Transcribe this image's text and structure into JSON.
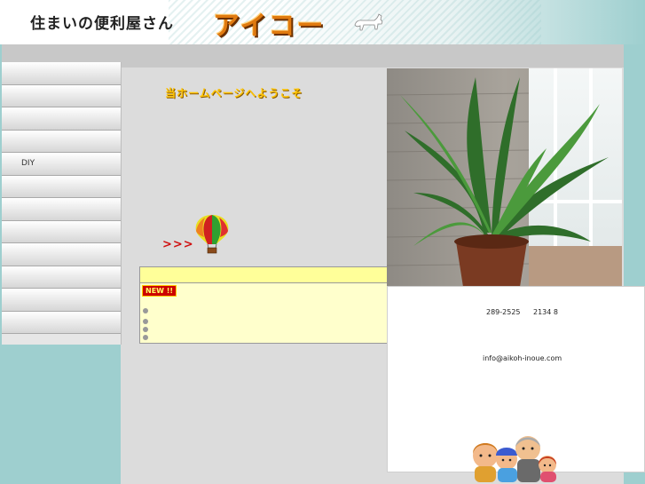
{
  "header": {
    "site_title": "住まいの便利屋さん",
    "logo_text": "アイコー"
  },
  "welcome": "当ホームページへようこそ",
  "arrows": ">>>",
  "sidebar": {
    "items": [
      {
        "label": ""
      },
      {
        "label": ""
      },
      {
        "label": ""
      },
      {
        "label": ""
      },
      {
        "label": "DIY"
      },
      {
        "label": ""
      },
      {
        "label": ""
      },
      {
        "label": ""
      },
      {
        "label": ""
      },
      {
        "label": ""
      },
      {
        "label": ""
      },
      {
        "label": ""
      }
    ]
  },
  "news": {
    "badge": "NEW !!"
  },
  "contact": {
    "phone": "289-2525",
    "fax": "2134 8",
    "email": "info@aikoh-inoue.com"
  },
  "colors": {
    "background": "#9ecfcf",
    "panel": "#dcdcdc",
    "logo": "#e07a10",
    "welcome": "#ffc400",
    "news_bg": "#ffffcc"
  }
}
